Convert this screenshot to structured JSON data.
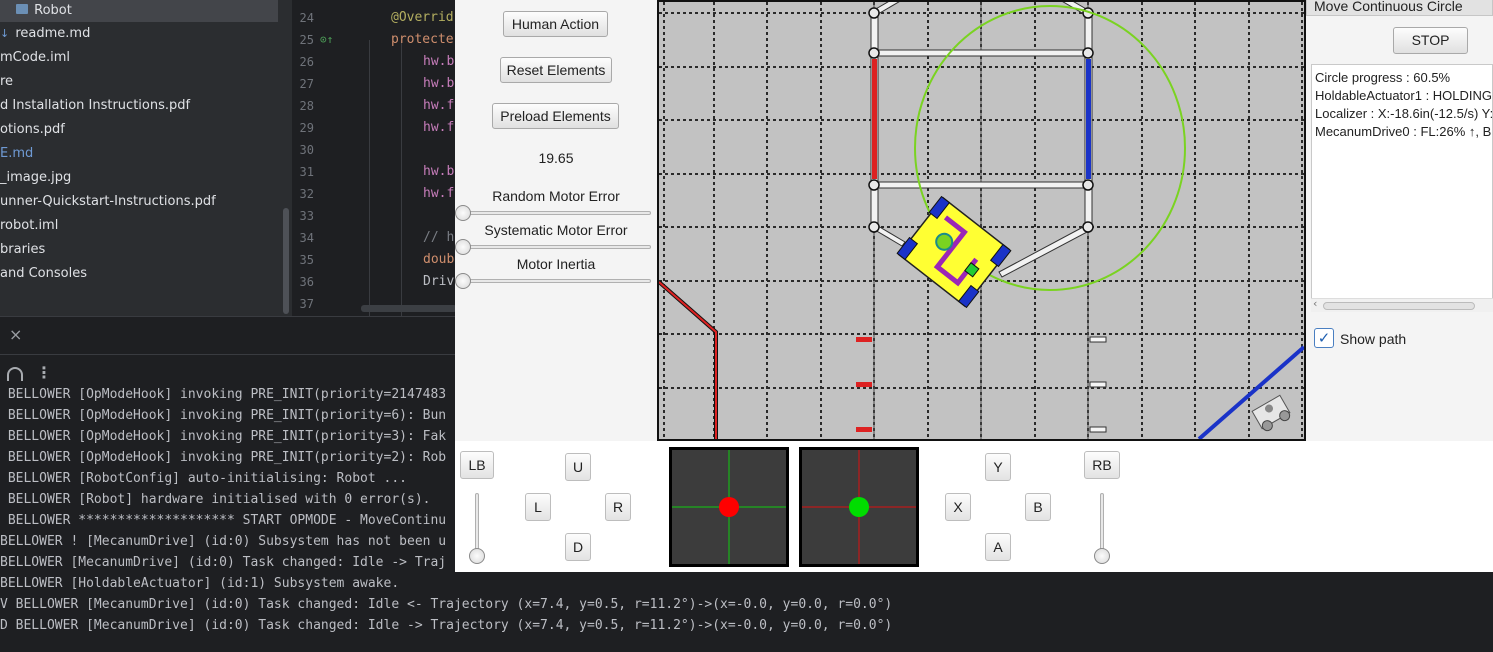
{
  "project_tree": {
    "items": [
      {
        "label": "Robot"
      },
      {
        "label": "readme.md",
        "prefix": "↓"
      },
      {
        "label": "mCode.iml"
      },
      {
        "label": "re"
      },
      {
        "label": "d Installation Instructions.pdf"
      },
      {
        "label": "otions.pdf"
      },
      {
        "label": "E.md"
      },
      {
        "label": "_image.jpg"
      },
      {
        "label": "unner-Quickstart-Instructions.pdf"
      },
      {
        "label": "robot.iml"
      },
      {
        "label": "braries"
      },
      {
        "label": "and Consoles"
      }
    ]
  },
  "editor": {
    "line_numbers": [
      "24",
      "25",
      "26",
      "27",
      "28",
      "29",
      "30",
      "31",
      "32",
      "33",
      "34",
      "35",
      "36",
      "37"
    ],
    "lines": [
      "@Overrid",
      "protecte",
      "hw.b",
      "hw.b",
      "hw.f",
      "hw.f",
      "",
      "hw.b",
      "hw.f",
      "",
      "// h",
      "doub",
      "Driv",
      ""
    ]
  },
  "console": {
    "close_icon": "×",
    "lines": [
      " BELLOWER [OpModeHook] invoking PRE_INIT(priority=2147483",
      " BELLOWER [OpModeHook] invoking PRE_INIT(priority=6): Bun",
      " BELLOWER [OpModeHook] invoking PRE_INIT(priority=3): Fak",
      " BELLOWER [OpModeHook] invoking PRE_INIT(priority=2): Rob",
      " BELLOWER [RobotConfig] auto-initialising: Robot ...",
      " BELLOWER [Robot] hardware initialised with 0 error(s).",
      " BELLOWER ******************** START OPMODE - MoveContinu",
      "BELLOWER ! [MecanumDrive] (id:0) Subsystem has not been u",
      "BELLOWER [MecanumDrive] (id:0) Task changed: Idle -> Traj",
      "BELLOWER [HoldableActuator] (id:1) Subsystem awake.",
      "V BELLOWER [MecanumDrive] (id:0) Task changed: Idle <- Trajectory (x=7.4, y=0.5, r=11.2°)->(x=-0.0, y=0.0, r=0.0°)",
      "D BELLOWER [MecanumDrive] (id:0) Task changed: Idle -> Trajectory (x=7.4, y=0.5, r=11.2°)->(x=-0.0, y=0.0, r=0.0°)"
    ]
  },
  "sim": {
    "buttons": {
      "human_action": "Human Action",
      "reset_elements": "Reset Elements",
      "preload_elements": "Preload Elements"
    },
    "timer": "19.65",
    "sliders": {
      "random_motor_error": {
        "label": "Random Motor Error",
        "value": 0
      },
      "systematic_motor_error": {
        "label": "Systematic Motor Error",
        "value": 0
      },
      "motor_inertia": {
        "label": "Motor Inertia",
        "value": 0
      }
    },
    "telemetry": {
      "opmode_title": "Move Continuous Circle",
      "stop_label": "STOP",
      "lines": [
        "Circle progress : 60.5%",
        "HoldableActuator1 : HOLDING",
        "Localizer : X:-18.6in(-12.5/s) Y:",
        "MecanumDrive0 : FL:26% ↑, B"
      ],
      "show_path_label": "Show path",
      "show_path_checked": true
    },
    "gamepad": {
      "lb": "LB",
      "rb": "RB",
      "dpad": {
        "up": "U",
        "down": "D",
        "left": "L",
        "right": "R"
      },
      "face": {
        "y": "Y",
        "x": "X",
        "b": "B",
        "a": "A"
      },
      "left_stick": {
        "x": 0,
        "y": 0
      },
      "right_stick": {
        "x": 0,
        "y": 0
      },
      "left_trigger": 0,
      "right_trigger": 0
    },
    "colors": {
      "red_alliance": "#dd2222",
      "blue_alliance": "#1a33c8",
      "robot_body": "#ffff33",
      "path_circle": "#7ad321",
      "left_stick_dot": "#ff0000",
      "right_stick_dot": "#00dd00"
    }
  }
}
